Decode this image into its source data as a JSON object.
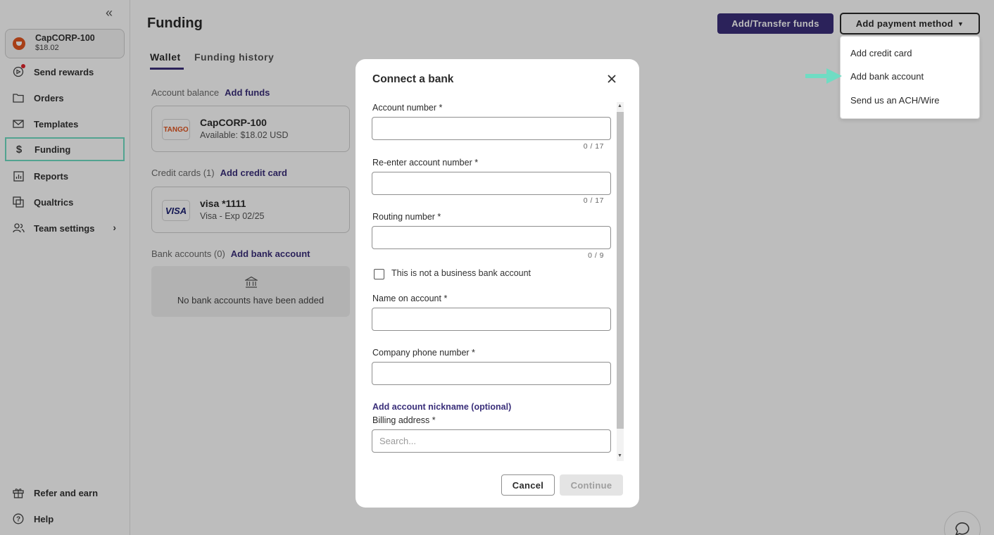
{
  "sidebar": {
    "collapse_icon": "double-chevron-left-icon",
    "account": {
      "name": "CapCORP-100",
      "balance": "$18.02"
    },
    "items": [
      {
        "label": "Send rewards",
        "icon": "send-rewards-icon"
      },
      {
        "label": "Orders",
        "icon": "folder-icon"
      },
      {
        "label": "Templates",
        "icon": "envelope-icon"
      },
      {
        "label": "Funding",
        "icon": "dollar-icon"
      },
      {
        "label": "Reports",
        "icon": "chart-icon"
      },
      {
        "label": "Qualtrics",
        "icon": "qualtrics-icon"
      },
      {
        "label": "Team settings",
        "icon": "team-icon"
      }
    ],
    "bottom_items": [
      {
        "label": "Refer and earn",
        "icon": "gift-icon"
      },
      {
        "label": "Help",
        "icon": "help-icon"
      }
    ]
  },
  "main": {
    "title": "Funding",
    "tabs": [
      {
        "label": "Wallet"
      },
      {
        "label": "Funding history"
      }
    ],
    "account_balance": {
      "label": "Account balance",
      "link": "Add funds"
    },
    "wallet_card": {
      "logo": "TANGO",
      "name": "CapCORP-100",
      "available": "Available: $18.02 USD"
    },
    "credit_cards": {
      "label": "Credit cards (1)",
      "link": "Add credit card"
    },
    "card": {
      "logo": "VISA",
      "name": "visa *1111",
      "detail": "Visa - Exp 02/25"
    },
    "bank_accounts": {
      "label": "Bank accounts (0)",
      "link": "Add bank account"
    },
    "empty_bank": "No bank accounts have been added"
  },
  "header": {
    "add_transfer": "Add/Transfer funds",
    "add_payment": "Add payment method"
  },
  "menu": {
    "items": [
      "Add credit card",
      "Add bank account",
      "Send us an ACH/Wire"
    ]
  },
  "modal": {
    "title": "Connect a bank",
    "fields": {
      "account_number": {
        "label": "Account number *",
        "counter": "0 / 17"
      },
      "reenter": {
        "label": "Re-enter account number *",
        "counter": "0 / 17"
      },
      "routing": {
        "label": "Routing number *",
        "counter": "0 / 9"
      },
      "checkbox": "This is not a business bank account",
      "name": {
        "label": "Name on account *"
      },
      "phone": {
        "label": "Company phone number *"
      },
      "nickname_link": "Add account nickname (optional)",
      "billing": {
        "label": "Billing address *",
        "placeholder": "Search..."
      }
    },
    "cancel": "Cancel",
    "continue": "Continue"
  },
  "colors": {
    "brand": "#3a2f7a",
    "accent_teal": "#6fdcc3",
    "overlay": "rgba(0,0,0,0.26)"
  }
}
